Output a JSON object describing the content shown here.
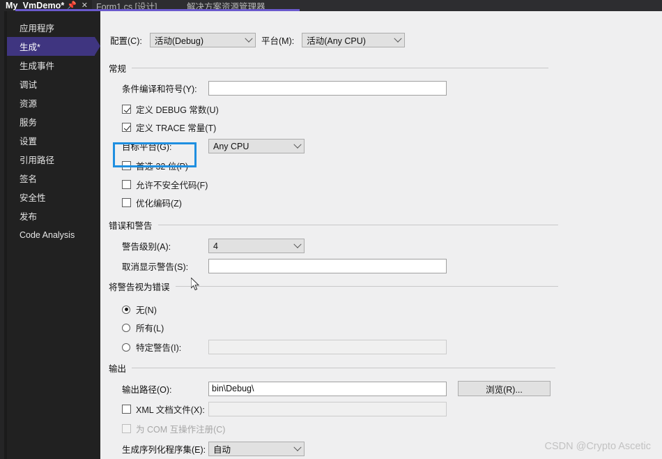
{
  "window": {
    "tabs": [
      {
        "title": "My_VmDemo*",
        "active": true,
        "pin_icon": "pin-icon",
        "close_icon": "close-icon"
      },
      {
        "title": "Form1.cs [设计]",
        "active": false
      },
      {
        "title": "解决方案资源管理器",
        "active": false
      }
    ],
    "accent_color": "#6a5acd"
  },
  "sidebar": {
    "selected_index": 1,
    "selected_color": "#3f3580",
    "items": [
      {
        "label": "应用程序"
      },
      {
        "label": "生成*"
      },
      {
        "label": "生成事件"
      },
      {
        "label": "调试"
      },
      {
        "label": "资源"
      },
      {
        "label": "服务"
      },
      {
        "label": "设置"
      },
      {
        "label": "引用路径"
      },
      {
        "label": "签名"
      },
      {
        "label": "安全性"
      },
      {
        "label": "发布"
      },
      {
        "label": "Code Analysis"
      }
    ]
  },
  "top": {
    "configuration_label": "配置(C):",
    "configuration_value": "活动(Debug)",
    "platform_label": "平台(M):",
    "platform_value": "活动(Any CPU)"
  },
  "general": {
    "section_title": "常规",
    "conditional_symbols_label": "条件编译和符号(Y):",
    "conditional_symbols_value": "",
    "define_debug_label": "定义 DEBUG 常数(U)",
    "define_debug_checked": true,
    "define_trace_label": "定义 TRACE 常量(T)",
    "define_trace_checked": true,
    "target_platform_label": "目标平台(G):",
    "target_platform_value": "Any CPU",
    "prefer32_label": "首选 32 位(P)",
    "prefer32_checked": false,
    "unsafe_label": "允许不安全代码(F)",
    "unsafe_checked": false,
    "optimize_label": "优化编码(Z)",
    "optimize_checked": false
  },
  "errors": {
    "section_title": "错误和警告",
    "warning_level_label": "警告级别(A):",
    "warning_level_value": "4",
    "suppress_warnings_label": "取消显示警告(S):",
    "suppress_warnings_value": ""
  },
  "warnings_as_errors": {
    "section_title": "将警告视为错误",
    "none_label": "无(N)",
    "all_label": "所有(L)",
    "specific_label": "特定警告(I):",
    "selected": "none",
    "specific_value": ""
  },
  "output": {
    "section_title": "输出",
    "output_path_label": "输出路径(O):",
    "output_path_value": "bin\\Debug\\",
    "browse_button": "浏览(R)...",
    "xml_doc_label": "XML 文档文件(X):",
    "xml_doc_checked": false,
    "xml_doc_value": "",
    "com_interop_label": "为 COM 互操作注册(C)",
    "com_interop_checked": false,
    "com_interop_disabled": true,
    "serialization_label": "生成序列化程序集(E):",
    "serialization_value": "自动"
  },
  "annotation": {
    "highlight_color": "#1f8fe0"
  },
  "watermark": {
    "text": "CSDN @Crypto Ascetic"
  }
}
